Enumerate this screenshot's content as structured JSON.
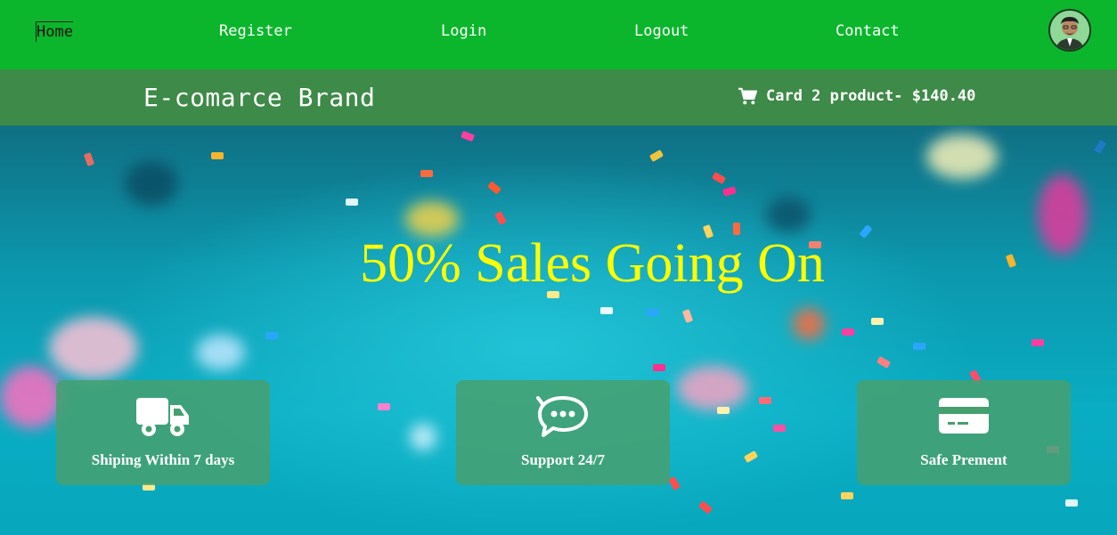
{
  "nav": {
    "home": "Home",
    "register": "Register",
    "login": "Login",
    "logout": "Logout",
    "contact": "Contact",
    "avatar_icon": "user-avatar"
  },
  "brandbar": {
    "brand": "E-comarce Brand",
    "cart_icon": "cart-icon",
    "cart_text": "Card 2 product- $140.40"
  },
  "hero": {
    "headline": "50% Sales Going On",
    "headline_color": "#ffff00",
    "features": [
      {
        "icon": "truck-icon",
        "label": "Shiping Within 7 days"
      },
      {
        "icon": "chat-icon",
        "label": "Support 24/7"
      },
      {
        "icon": "credit-card-icon",
        "label": "Safe Prement"
      }
    ]
  },
  "colors": {
    "nav_bg": "#0bb62c",
    "brandbar_bg": "#3e8a48",
    "feature_bg": "#46a06e"
  }
}
